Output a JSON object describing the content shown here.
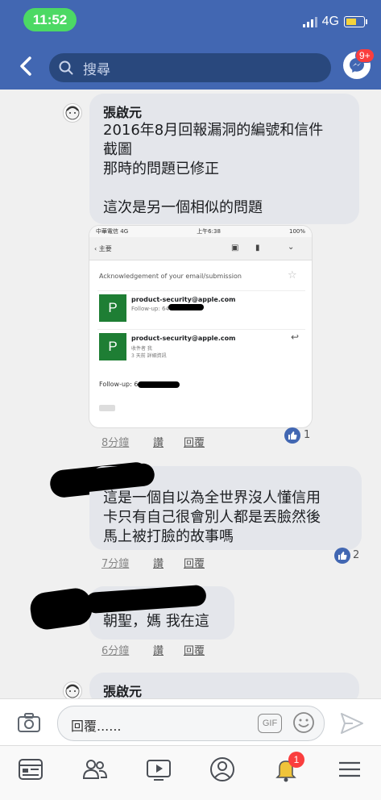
{
  "status_bar": {
    "time": "11:52",
    "network": "4G"
  },
  "header": {
    "search_placeholder": "搜尋",
    "messenger_badge": "9+"
  },
  "comments": [
    {
      "author": "張啟元",
      "text_lines": [
        "2016年8月回報漏洞的編號和信件",
        "截圖",
        "那時的問題已修正",
        "",
        "這次是另一個相似的問題"
      ],
      "time": "8分鐘",
      "like_label": "讚",
      "reply_label": "回覆",
      "reactions": "1",
      "attachment": {
        "carrier": "中華電信",
        "network": "4G",
        "time": "上午6:38",
        "battery": "100%",
        "back_label": "主要",
        "subject": "Acknowledgement of your email/submission",
        "email1_from": "product-security@apple.com",
        "email1_snippet": "Follow-up: 64",
        "email2_from": "product-security@apple.com",
        "email2_to": "收件者 我",
        "email2_when": "3 天前",
        "email2_details": "詳細資訊",
        "email2_body": "Follow-up: 6",
        "sender_initial": "P"
      }
    },
    {
      "author": "",
      "text_lines": [
        "這是一個自以為全世界沒人懂信用",
        "卡只有自己很會別人都是丟臉然後",
        "馬上被打臉的故事嗎"
      ],
      "time": "7分鐘",
      "like_label": "讚",
      "reply_label": "回覆",
      "reactions": "2"
    },
    {
      "author": "",
      "text_lines": [
        "朝聖，媽 我在這"
      ],
      "time": "6分鐘",
      "like_label": "讚",
      "reply_label": "回覆"
    },
    {
      "author": "張啟元"
    }
  ],
  "composer": {
    "placeholder": "回覆......",
    "gif_label": "GIF"
  },
  "tab_bar": {
    "notification_badge": "1"
  },
  "colors": {
    "brand": "#4267b2",
    "bubble": "#e4e6eb",
    "status_green": "#4cd964",
    "badge_red": "#fa3e3e"
  }
}
